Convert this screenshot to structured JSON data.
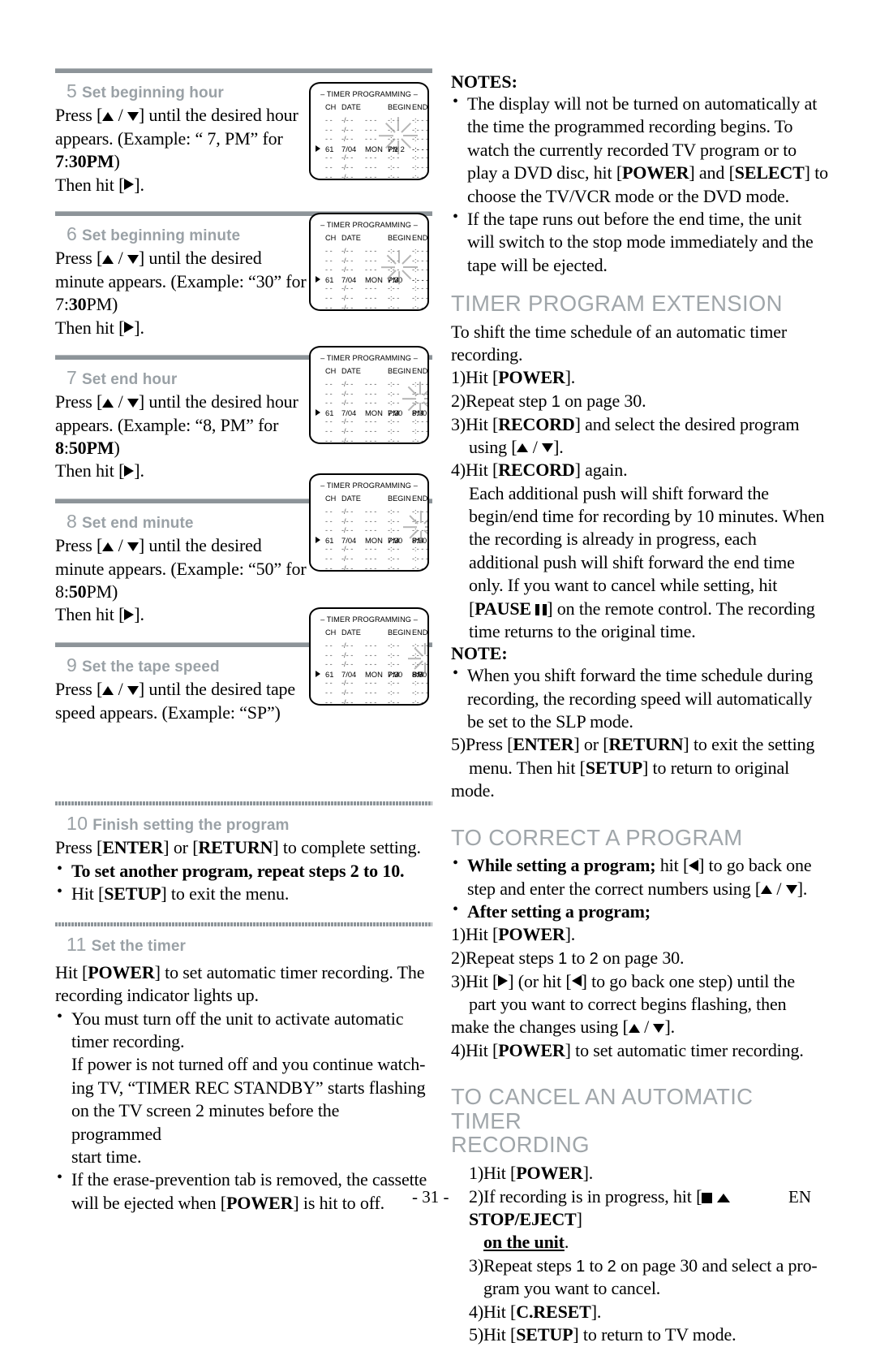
{
  "page": {
    "number": "- 31 -",
    "lang": "EN"
  },
  "left_column": {
    "steps": [
      {
        "num": "5",
        "title": "Set beginning hour",
        "lines": [
          "Press [▲ / ▼] until the desired hour",
          "appears.  (Example: “ 7, PM” for",
          "7:30PM)",
          "Then hit [▶]."
        ]
      },
      {
        "num": "6",
        "title": "Set beginning minute",
        "lines": [
          "Press [▲ / ▼] until the desired",
          "minute appears.  (Example: “30”",
          "for 7:30PM)",
          "Then hit [▶]."
        ]
      },
      {
        "num": "7",
        "title": "Set end hour",
        "lines": [
          "Press [▲ / ▼] until the desired hour",
          "appears.  (Example: “8, PM” for",
          "8:50PM)",
          "Then hit [▶]."
        ]
      },
      {
        "num": "8",
        "title": "Set end minute",
        "lines": [
          "Press [▲ / ▼] until the desired",
          "minute appears.  (Example: “50”",
          "for 8:50PM)",
          "Then hit [▶]."
        ]
      },
      {
        "num": "9",
        "title": "Set the tape speed",
        "lines": [
          "Press [▲ / ▼] until the desired tape",
          "speed appears. (Example: “SP”)"
        ]
      },
      {
        "num": "10",
        "title": "Finish setting the program",
        "lines": [
          "Press [ENTER] or [RETURN] to complete setting.",
          "• To set another program, repeat steps 2 to 10.",
          "• Hit [SETUP] to exit the menu."
        ]
      },
      {
        "num": "11",
        "title": "Set the timer",
        "lines": [
          "Hit [POWER] to set automatic timer recording. The",
          "recording indicator lights up.",
          "• You must turn off the unit to activate automatic timer recording.",
          "If power is not turned off and you continue watching TV, “TIMER REC STANDBY” starts flashing on the TV screen 2 minutes before the programmed start time.",
          "• If the erase-prevention tab is removed, the cassette will be ejected when [POWER] is hit to off."
        ]
      }
    ]
  },
  "tv_screens": {
    "title": "– TIMER PROGRAMMING –",
    "headers": {
      "ch": "CH",
      "date": "DATE",
      "begin": "BEGIN",
      "end": "END"
    },
    "empty_row": {
      "ch": "- -",
      "date": "-/- -",
      "day": "- - -",
      "begin": "-:- -",
      "end": "-:- -   - -"
    },
    "screens": [
      {
        "id": "screen-step5",
        "active": {
          "ch": "61",
          "date": "7/04",
          "day": "MON",
          "begin": "7:1 2",
          "begin_ampm": "PM",
          "end": "",
          "end_ampm": "",
          "speed": ""
        },
        "flash": "begin-hour"
      },
      {
        "id": "screen-step6",
        "active": {
          "ch": "61",
          "date": "7/04",
          "day": "MON",
          "begin": "7:30",
          "begin_ampm": "PM",
          "end": "",
          "end_ampm": "",
          "speed": ""
        },
        "flash": "begin-minute"
      },
      {
        "id": "screen-step7",
        "active": {
          "ch": "61",
          "date": "7/04",
          "day": "MON",
          "begin": "7:30",
          "begin_ampm": "PM",
          "end": "8:30",
          "end_ampm": "PM",
          "speed": ""
        },
        "flash": "end-hour"
      },
      {
        "id": "screen-step8",
        "active": {
          "ch": "61",
          "date": "7/04",
          "day": "MON",
          "begin": "7:30",
          "begin_ampm": "PM",
          "end": "8:50",
          "end_ampm": "PM",
          "speed": ""
        },
        "flash": "end-minute"
      },
      {
        "id": "screen-step9",
        "active": {
          "ch": "61",
          "date": "7/04",
          "day": "MON",
          "begin": "7:30",
          "begin_ampm": "PM",
          "end": "8:50",
          "end_ampm": "PM",
          "speed": "SP"
        },
        "flash": "speed"
      }
    ]
  },
  "right_column": {
    "notes_heading": "NOTES:",
    "notes": [
      "The display will not be turned on automatically at the time the programmed recording begins. To watch the currently recorded TV program or to play a DVD disc, hit [POWER] and [SELECT] to choose the TV/VCR mode or the DVD mode.",
      "If the tape runs out before the end time, the unit will switch to the stop mode immediately and the tape will be ejected."
    ],
    "section_extension": {
      "heading": "TIMER PROGRAM EXTENSION",
      "intro": "To shift the time schedule of an automatic timer recording.",
      "steps": [
        "1)Hit [POWER].",
        "2)Repeat step 1 on page 30.",
        "3)Hit [RECORD] and select the desired program using [▲ / ▼].",
        "4)Hit [RECORD] again.",
        "Each additional push will shift forward the begin/end time for recording by 10 minutes. When the recording is already in progress, each additional push will shift forward the end time only. If you want to cancel while setting, hit [PAUSE ❙❙] on the remote control. The recording time returns to the original time."
      ],
      "note_heading": "NOTE:",
      "note": "When you shift forward the time schedule during recording, the recording speed will automatically be set to the SLP mode.",
      "last_step": "5)Press [ENTER] or [RETURN] to exit the setting menu. Then hit [SETUP] to return to original mode."
    },
    "section_correct": {
      "heading": "TO CORRECT A PROGRAM",
      "bullet_while": "While setting a program;",
      "bullet_while_rest": " hit [◀] to go back one step and enter the correct numbers using [▲ / ▼].",
      "bullet_after": "After setting a program;",
      "steps": [
        "1)Hit [POWER].",
        "2)Repeat steps 1 to 2 on page 30.",
        "3)Hit [▶] (or hit [◀] to go back one step) until the part you want to correct begins flashing, then make the changes using [▲ / ▼].",
        "4)Hit [POWER] to set automatic timer recording."
      ]
    },
    "section_cancel": {
      "heading_line1": "TO CANCEL AN AUTOMATIC TIMER",
      "heading_line2": "RECORDING",
      "steps": [
        "1)Hit [POWER].",
        "2)If recording is in progress, hit [■ ▲ STOP/EJECT] on the unit.",
        "3)Repeat steps 1 to 2 on page 30 and select a program you want to cancel.",
        "4)Hit [C.RESET].",
        "5)Hit [SETUP] to return to TV mode."
      ]
    }
  }
}
